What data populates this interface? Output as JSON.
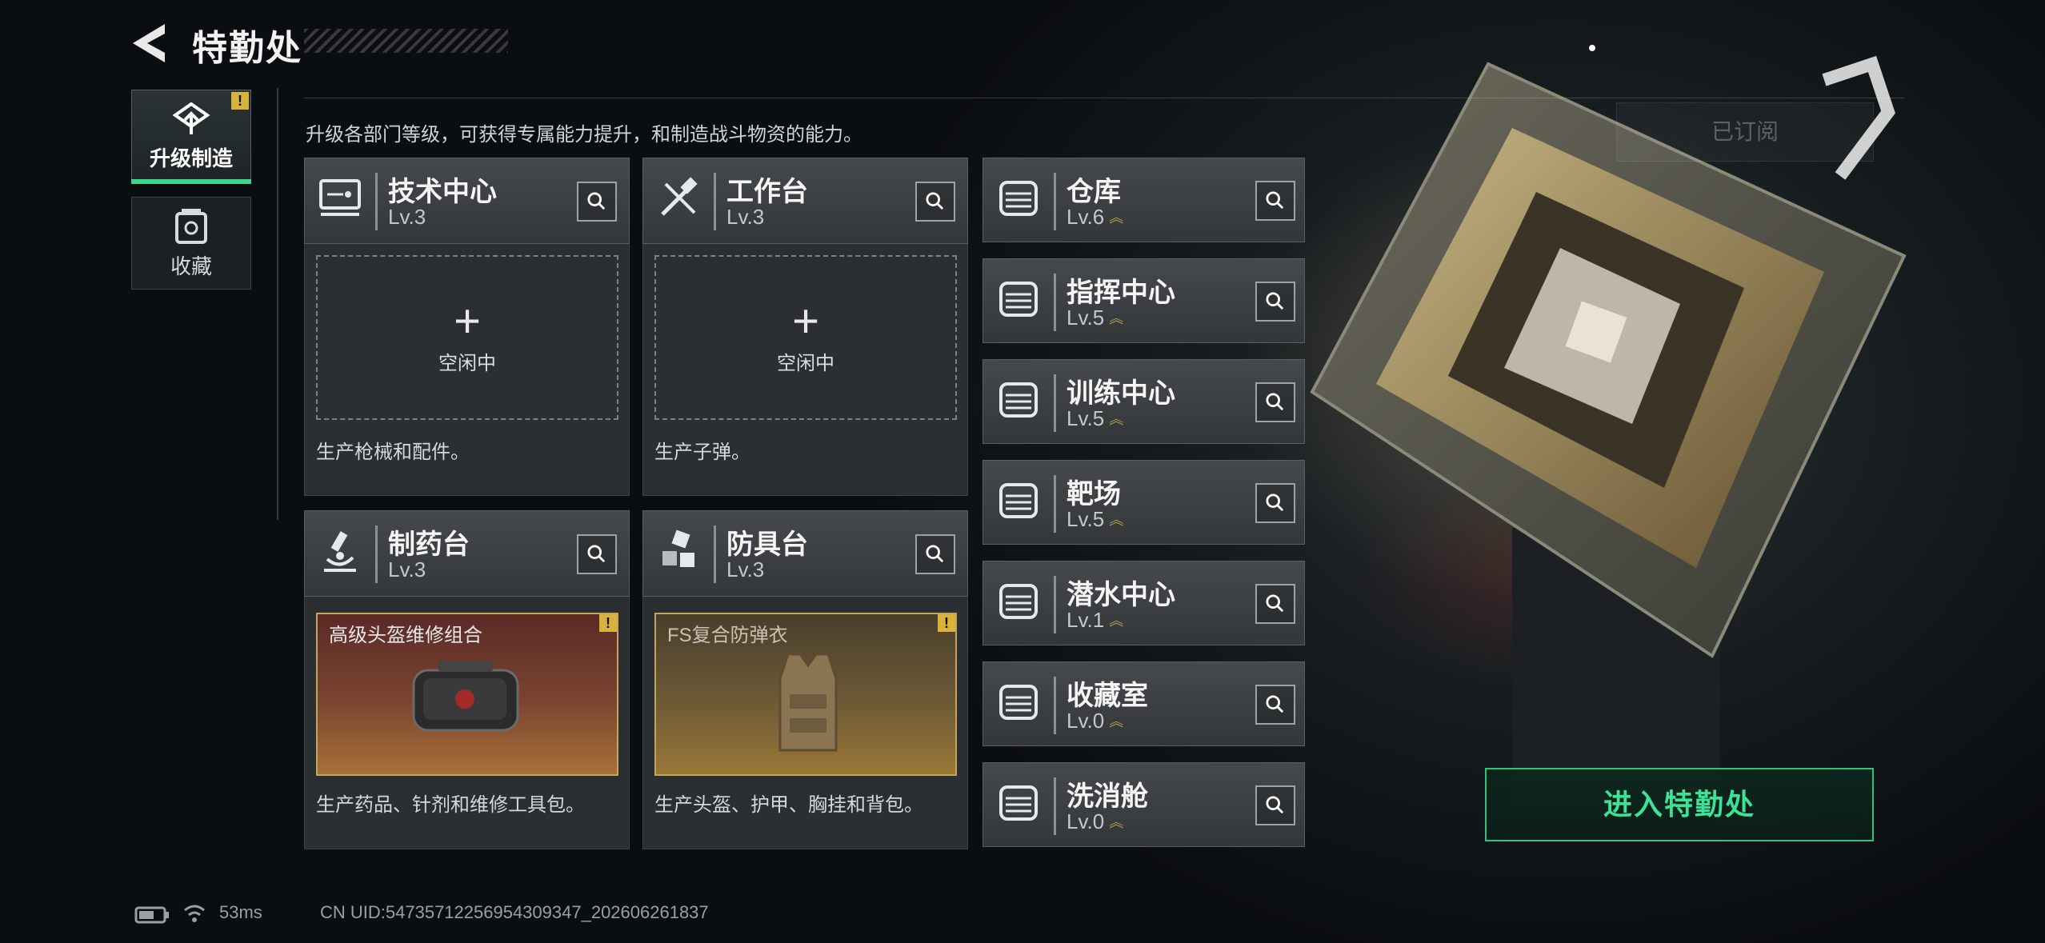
{
  "header": {
    "title": "特勤处"
  },
  "sidebar": {
    "items": [
      {
        "label": "升级制造",
        "active": true,
        "warning": "!"
      },
      {
        "label": "收藏",
        "active": false
      }
    ]
  },
  "description": "升级各部门等级，可获得专属能力提升，和制造战斗物资的能力。",
  "subscribe_label": "已订阅",
  "left_cards": [
    {
      "name": "技术中心",
      "level": "Lv.3",
      "idle_label": "空闲中",
      "body_text": "生产枪械和配件。",
      "icon": "monitor-icon"
    },
    {
      "name": "工作台",
      "level": "Lv.3",
      "idle_label": "空闲中",
      "body_text": "生产子弹。",
      "icon": "tools-icon"
    },
    {
      "name": "制药台",
      "level": "Lv.3",
      "item_name": "高级头盔维修组合",
      "item_warning": "!",
      "body_text": "生产药品、针剂和维修工具包。",
      "icon": "microscope-icon",
      "item_colors": [
        "#5b2a26",
        "#a8703a"
      ]
    },
    {
      "name": "防具台",
      "level": "Lv.3",
      "item_name": "FS复合防弹衣",
      "item_warning": "!",
      "body_text": "生产头盔、护甲、胸挂和背包。",
      "icon": "cubes-icon",
      "item_colors": [
        "#5b4a2c",
        "#9a7836"
      ]
    }
  ],
  "right_cards": [
    {
      "name": "仓库",
      "level": "Lv.6",
      "icon": "warehouse-icon"
    },
    {
      "name": "指挥中心",
      "level": "Lv.5",
      "icon": "command-icon"
    },
    {
      "name": "训练中心",
      "level": "Lv.5",
      "icon": "dumbbell-icon"
    },
    {
      "name": "靶场",
      "level": "Lv.5",
      "icon": "target-icon"
    },
    {
      "name": "潜水中心",
      "level": "Lv.1",
      "icon": "diving-mask-icon"
    },
    {
      "name": "收藏室",
      "level": "Lv.0",
      "icon": "collection-icon"
    },
    {
      "name": "洗消舱",
      "level": "Lv.0",
      "icon": "radiation-icon"
    }
  ],
  "enter_button": "进入特勤处",
  "status": {
    "ping": "53ms",
    "uid": "CN UID:5473571225695430934​7_202606261837"
  },
  "colors": {
    "accent": "#39d68c",
    "gold": "#c8a35a"
  }
}
